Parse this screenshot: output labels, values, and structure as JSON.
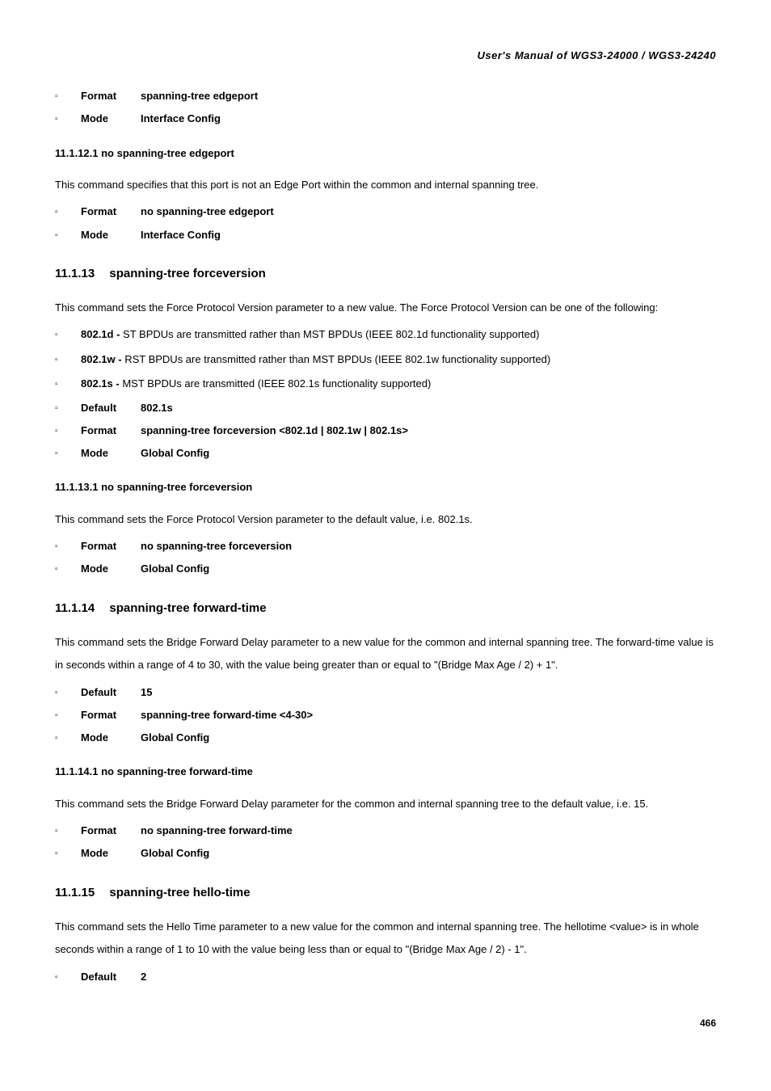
{
  "header": "User's  Manual  of  WGS3-24000  /  WGS3-24240",
  "topParams": [
    {
      "key": "Format",
      "val": "spanning-tree edgeport"
    },
    {
      "key": "Mode",
      "val": "Interface Config"
    }
  ],
  "s11_1_12_1": {
    "title": "11.1.12.1 no spanning-tree edgeport",
    "desc": "This command specifies that this port is not an Edge Port within the common and internal spanning tree.",
    "params": [
      {
        "key": "Format",
        "val": "no spanning-tree edgeport"
      },
      {
        "key": "Mode",
        "val": "Interface Config"
      }
    ]
  },
  "s11_1_13": {
    "num": "11.1.13",
    "title": "spanning-tree forceversion",
    "desc": "This command sets the Force Protocol Version parameter to a new value. The Force Protocol Version can be one of the following:",
    "protocols": [
      {
        "key": "802.1d - ",
        "text": "ST BPDUs are transmitted rather than MST BPDUs (IEEE 802.1d functionality supported)"
      },
      {
        "key": "802.1w - ",
        "text": "RST BPDUs are transmitted rather than MST BPDUs (IEEE 802.1w functionality supported)"
      },
      {
        "key": "802.1s - ",
        "text": "MST BPDUs are transmitted (IEEE 802.1s functionality supported)"
      }
    ],
    "params": [
      {
        "key": "Default",
        "val": "802.1s"
      },
      {
        "key": "Format",
        "val": "spanning-tree forceversion <802.1d | 802.1w | 802.1s>"
      },
      {
        "key": "Mode",
        "val": "Global Config"
      }
    ]
  },
  "s11_1_13_1": {
    "title": "11.1.13.1 no spanning-tree forceversion",
    "desc": "This command sets the Force Protocol Version parameter to the default value, i.e. 802.1s.",
    "params": [
      {
        "key": "Format",
        "val": "no spanning-tree forceversion"
      },
      {
        "key": "Mode",
        "val": "Global Config"
      }
    ]
  },
  "s11_1_14": {
    "num": "11.1.14",
    "title": "spanning-tree forward-time",
    "desc": "This command sets the Bridge Forward Delay parameter to a new value for the common and internal spanning tree. The forward-time value is in seconds within a range of 4 to 30, with the value being greater than or equal to \"(Bridge Max Age / 2) + 1\".",
    "params": [
      {
        "key": "Default",
        "val": "15"
      },
      {
        "key": "Format",
        "val": "spanning-tree forward-time <4-30>"
      },
      {
        "key": "Mode",
        "val": "Global Config"
      }
    ]
  },
  "s11_1_14_1": {
    "title": "11.1.14.1 no spanning-tree forward-time",
    "desc": "This command sets the Bridge Forward Delay parameter for the common and internal spanning tree to the default value, i.e. 15.",
    "params": [
      {
        "key": "Format",
        "val": "no spanning-tree forward-time"
      },
      {
        "key": "Mode",
        "val": "Global Config"
      }
    ]
  },
  "s11_1_15": {
    "num": "11.1.15",
    "title": "spanning-tree hello-time",
    "desc": "This command sets the Hello Time parameter to a new value for the common and internal spanning tree. The hellotime <value> is in whole seconds within a range of 1 to 10 with the value being less than or equal to \"(Bridge Max Age / 2) - 1\".",
    "params": [
      {
        "key": "Default",
        "val": "2"
      }
    ]
  },
  "pageNum": "466"
}
